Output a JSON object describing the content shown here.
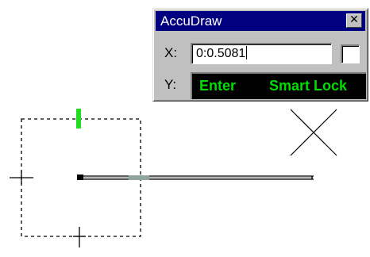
{
  "accudraw": {
    "title": "AccuDraw",
    "close_glyph": "✕",
    "x_label": "X:",
    "x_value": "0:0.5081",
    "y_label": "Y:",
    "status_primary": "Enter",
    "status_secondary": "Smart Lock",
    "lock_checked": false
  },
  "colors": {
    "titlebar": "#000080",
    "dialog_face": "#c0c0c0",
    "status_background": "#000000",
    "status_text": "#00dd00",
    "compass_tick_active": "#22dd22",
    "drawing_line": "#000000"
  },
  "icons": {
    "close": "close-icon",
    "cursor": "crosshair-cursor-icon"
  }
}
